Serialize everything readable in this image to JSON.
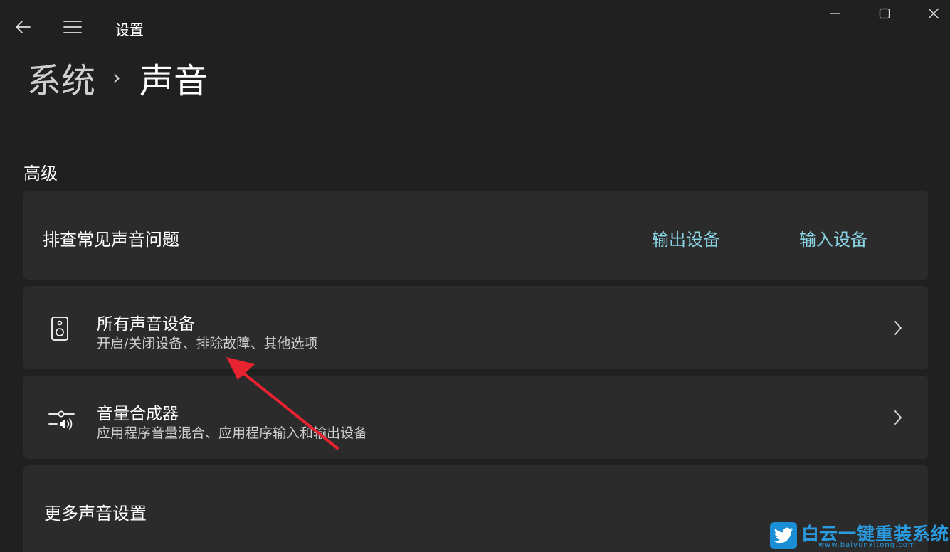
{
  "window": {
    "title": "设置",
    "back_icon": "arrow-left-icon",
    "menu_icon": "hamburger-icon",
    "controls": [
      "minimize-icon",
      "maximize-icon",
      "close-icon"
    ]
  },
  "breadcrumb": {
    "parent": "系统",
    "separator": "›",
    "current": "声音"
  },
  "section": {
    "title": "高级"
  },
  "troubleshoot": {
    "title": "排查常见声音问题",
    "output_link": "输出设备",
    "input_link": "输入设备"
  },
  "all_devices": {
    "icon": "speaker-icon",
    "title": "所有声音设备",
    "subtitle": "开启/关闭设备、排除故障、其他选项"
  },
  "volume_mixer": {
    "icon": "volume-mixer-icon",
    "title": "音量合成器",
    "subtitle": "应用程序音量混合、应用程序输入和输出设备"
  },
  "more_settings": {
    "title": "更多声音设置"
  },
  "watermark": {
    "text": "白云一键重装系统",
    "url": "www.baiyunxitong.com"
  },
  "colors": {
    "background": "#202020",
    "card": "#2b2b2b",
    "link": "#8ad4e4",
    "annotation": "#e8232f"
  }
}
